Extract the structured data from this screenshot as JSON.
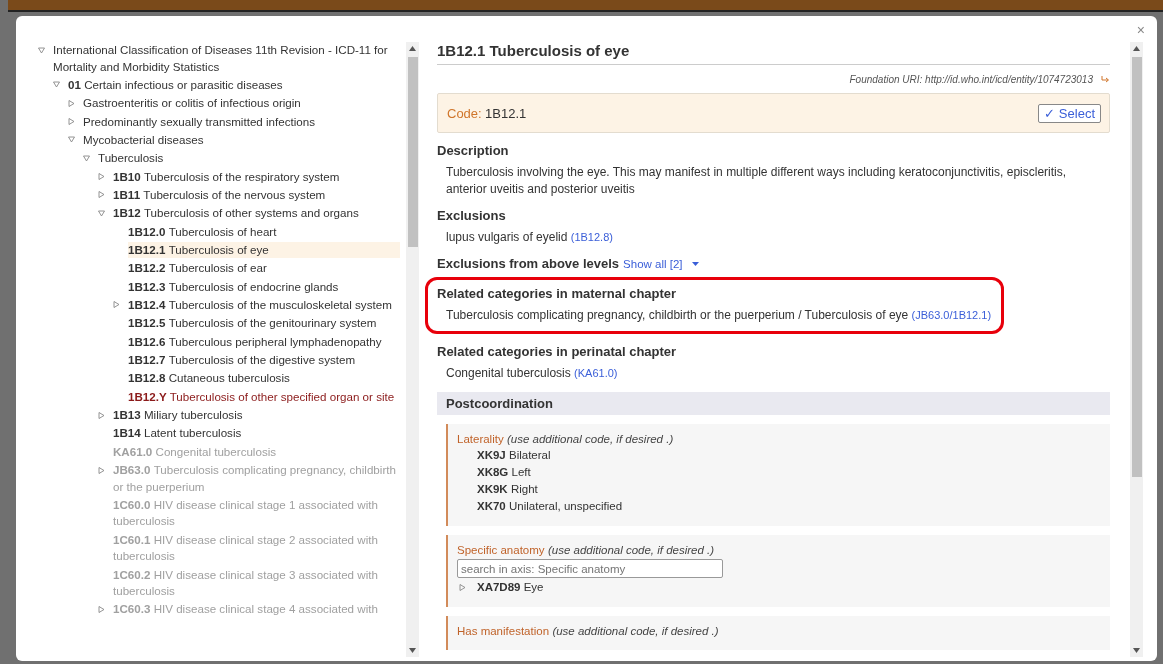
{
  "tree": [
    {
      "title": "International Classification of Diseases 11th Revision - ICD-11 for Mortality and Morbidity Statistics",
      "color": "#333333",
      "selected": false,
      "expanded": true,
      "children": [
        {
          "code": "01",
          "title": "Certain infectious or parasitic diseases",
          "color": "#333333",
          "selected": false,
          "expanded": true,
          "children": [
            {
              "title": "Gastroenteritis or colitis of infectious origin",
              "color": "#333333",
              "selected": false,
              "expanded": false
            },
            {
              "title": "Predominantly sexually transmitted infections",
              "color": "#333333",
              "selected": false,
              "expanded": false
            },
            {
              "title": "Mycobacterial diseases",
              "color": "#333333",
              "selected": false,
              "expanded": true,
              "children": [
                {
                  "title": "Tuberculosis",
                  "color": "#333333",
                  "selected": false,
                  "expanded": true,
                  "children": [
                    {
                      "code": "1B10",
                      "title": "Tuberculosis of the respiratory system",
                      "color": "#333333",
                      "selected": false,
                      "expanded": false
                    },
                    {
                      "code": "1B11",
                      "title": "Tuberculosis of the nervous system",
                      "color": "#333333",
                      "selected": false,
                      "expanded": false
                    },
                    {
                      "code": "1B12",
                      "title": "Tuberculosis of other systems and organs",
                      "color": "#333333",
                      "selected": false,
                      "expanded": true,
                      "children": [
                        {
                          "code": "1B12.0",
                          "title": "Tuberculosis of heart",
                          "color": "#333333",
                          "selected": false
                        },
                        {
                          "code": "1B12.1",
                          "title": "Tuberculosis of eye",
                          "color": "#333333",
                          "selected": true
                        },
                        {
                          "code": "1B12.2",
                          "title": "Tuberculosis of ear",
                          "color": "#333333",
                          "selected": false
                        },
                        {
                          "code": "1B12.3",
                          "title": "Tuberculosis of endocrine glands",
                          "color": "#333333",
                          "selected": false
                        },
                        {
                          "code": "1B12.4",
                          "title": "Tuberculosis of the musculoskeletal system",
                          "color": "#333333",
                          "selected": false,
                          "expanded": false
                        },
                        {
                          "code": "1B12.5",
                          "title": "Tuberculosis of the genitourinary system",
                          "color": "#333333",
                          "selected": false
                        },
                        {
                          "code": "1B12.6",
                          "title": "Tuberculous peripheral lymphadenopathy",
                          "color": "#333333",
                          "selected": false
                        },
                        {
                          "code": "1B12.7",
                          "title": "Tuberculosis of the digestive system",
                          "color": "#333333",
                          "selected": false
                        },
                        {
                          "code": "1B12.8",
                          "title": "Cutaneous tuberculosis",
                          "color": "#333333",
                          "selected": false
                        },
                        {
                          "code": "1B12.Y",
                          "title": "Tuberculosis of other specified organ or site",
                          "color": "#8b1a1a",
                          "selected": false
                        }
                      ]
                    },
                    {
                      "code": "1B13",
                      "title": "Miliary tuberculosis",
                      "color": "#333333",
                      "selected": false,
                      "expanded": false
                    },
                    {
                      "code": "1B14",
                      "title": "Latent tuberculosis",
                      "color": "#333333",
                      "selected": false
                    },
                    {
                      "code": "KA61.0",
                      "title": "Congenital tuberculosis",
                      "color": "#a0a0a0",
                      "selected": false
                    },
                    {
                      "code": "JB63.0",
                      "title": "Tuberculosis complicating pregnancy, childbirth or the puerperium",
                      "color": "#a0a0a0",
                      "selected": false,
                      "expanded": false
                    },
                    {
                      "code": "1C60.0",
                      "title": "HIV disease clinical stage 1 associated with tuberculosis",
                      "color": "#a0a0a0",
                      "selected": false
                    },
                    {
                      "code": "1C60.1",
                      "title": "HIV disease clinical stage 2 associated with tuberculosis",
                      "color": "#a0a0a0",
                      "selected": false
                    },
                    {
                      "code": "1C60.2",
                      "title": "HIV disease clinical stage 3 associated with tuberculosis",
                      "color": "#a0a0a0",
                      "selected": false
                    },
                    {
                      "code": "1C60.3",
                      "title": "HIV disease clinical stage 4 associated with",
                      "color": "#a0a0a0",
                      "selected": false,
                      "expanded": false
                    }
                  ]
                }
              ]
            }
          ]
        }
      ]
    }
  ],
  "close": "×",
  "detail": {
    "title": "1B12.1 Tuberculosis of eye",
    "uri": "Foundation URI: http://id.who.int/icd/entity/1074723013",
    "code_label": "Code:",
    "code": "1B12.1",
    "select_button": "✓ Select",
    "sections": [
      {
        "heading": "Description",
        "text": "Tuberculosis involving the eye. This may manifest in multiple different ways including keratoconjunctivitis, episcleritis, anterior uveitis and posterior uveitis",
        "highlighted": false
      },
      {
        "heading": "Exclusions",
        "text": "lupus vulgaris of eyelid",
        "ref": "(1B12.8)",
        "highlighted": false
      },
      {
        "heading": "Exclusions from above levels",
        "show_all": "Show all [2]",
        "highlighted": false
      },
      {
        "heading": "Related categories in maternal chapter",
        "text": "Tuberculosis complicating pregnancy, childbirth or the puerperium / Tuberculosis of eye",
        "ref": "(JB63.0/1B12.1)",
        "highlighted": true
      },
      {
        "heading": "Related categories in perinatal chapter",
        "text": "Congenital tuberculosis",
        "ref": "(KA61.0)",
        "highlighted": false
      }
    ],
    "postcoordination": {
      "heading": "Postcoordination",
      "axes": [
        {
          "name": "Laterality",
          "hint": "(use additional code, if desired .)",
          "items": [
            {
              "code": "XK9J",
              "title": "Bilateral"
            },
            {
              "code": "XK8G",
              "title": "Left"
            },
            {
              "code": "XK9K",
              "title": "Right"
            },
            {
              "code": "XK70",
              "title": "Unilateral, unspecified"
            }
          ]
        },
        {
          "name": "Specific anatomy",
          "hint": "(use additional code, if desired .)",
          "placeholder": "search in axis: Specific anatomy",
          "items": [
            {
              "code": "XA7D89",
              "title": "Eye",
              "expandable": true
            }
          ]
        },
        {
          "name": "Has manifestation",
          "hint": "(use additional code, if desired .)"
        }
      ]
    }
  }
}
